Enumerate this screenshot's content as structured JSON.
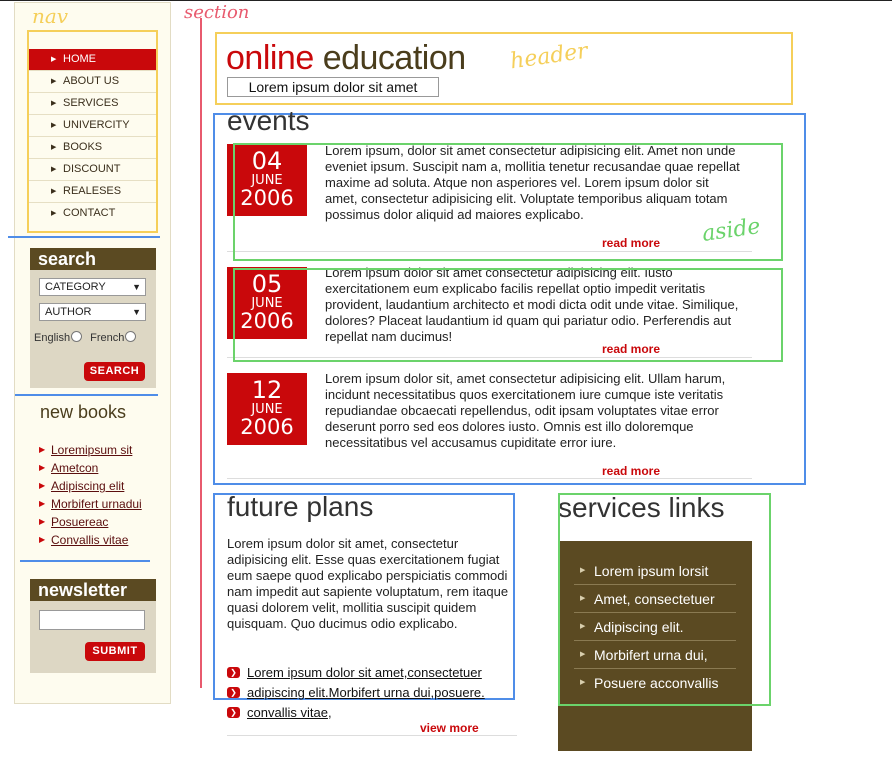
{
  "annotations": {
    "nav": "nav",
    "section": "section",
    "header": "header",
    "aside": "aside"
  },
  "nav": {
    "items": [
      {
        "label": "HOME",
        "active": true
      },
      {
        "label": "ABOUT US"
      },
      {
        "label": "SERVICES"
      },
      {
        "label": "UNIVERCITY"
      },
      {
        "label": "BOOKS"
      },
      {
        "label": "DISCOUNT"
      },
      {
        "label": "REALESES"
      },
      {
        "label": "CONTACT"
      }
    ]
  },
  "search": {
    "title": "search",
    "category": "CATEGORY",
    "author": "AUTHOR",
    "lang1": "English",
    "lang2": "French",
    "button": "SEARCH"
  },
  "new_books": {
    "title": "new books",
    "items": [
      "Loremipsum sit",
      "Ametcon",
      "Adipiscing elit",
      "Morbifert urnadui",
      "Posuereac",
      "Convallis vitae"
    ]
  },
  "newsletter": {
    "title": "newsletter",
    "input_value": "",
    "button": "SUBMIT"
  },
  "header": {
    "title_part1": "online",
    "title_part2": "education",
    "tagline": "Lorem ipsum dolor sit amet"
  },
  "events": {
    "title": "events",
    "items": [
      {
        "day": "04",
        "month": "JUNE",
        "year": "2006",
        "text": "Lorem ipsum, dolor sit amet consectetur adipisicing elit. Amet non unde eveniet ipsum. Suscipit nam a, mollitia tenetur recusandae quae repellat maxime ad soluta. Atque non asperiores vel. Lorem ipsum dolor sit amet, consectetur adipisicing elit. Voluptate temporibus aliquam totam possimus dolor aliquid ad maiores explicabo.",
        "read_more": "read more"
      },
      {
        "day": "05",
        "month": "JUNE",
        "year": "2006",
        "text": "Lorem ipsum dolor sit amet consectetur adipisicing elit. Iusto exercitationem eum explicabo facilis repellat optio impedit veritatis provident, laudantium architecto et modi dicta odit unde vitae. Similique, dolores? Placeat laudantium id quam qui pariatur odio. Perferendis aut repellat nam ducimus!",
        "read_more": "read more"
      },
      {
        "day": "12",
        "month": "JUNE",
        "year": "2006",
        "text": "Lorem ipsum dolor sit, amet consectetur adipisicing elit. Ullam harum, incidunt necessitatibus quos exercitationem iure cumque iste veritatis repudiandae obcaecati repellendus, odit ipsam voluptates vitae error deserunt porro sed eos dolores iusto. Omnis est illo doloremque necessitatibus vel accusamus cupiditate error iure.",
        "read_more": "read more"
      }
    ]
  },
  "future_plans": {
    "title": "future plans",
    "text": "Lorem ipsum dolor sit amet, consectetur adipisicing elit. Esse quas exercitationem fugiat eum saepe quod explicabo perspiciatis commodi nam impedit aut sapiente voluptatum, rem itaque quasi dolorem velit, mollitia suscipit quidem quisquam. Quo ducimus odio explicabo.",
    "links": [
      "Lorem ipsum dolor sit amet,consectetuer",
      "adipiscing elit.Morbifert urna dui,posuere.",
      "convallis vitae"
    ],
    "link3_suffix": ",",
    "view_more": "view more"
  },
  "services": {
    "title": "services links",
    "items": [
      "Lorem ipsum lorsit",
      "Amet, consectetuer",
      "Adipiscing elit.",
      "Morbifert urna dui,",
      "Posuere acconvallis"
    ]
  },
  "colors": {
    "red": "#c9080b",
    "brown": "#5b4a22",
    "blue_outline": "#4f8de8",
    "green_outline": "#6bd36b",
    "yellow_outline": "#f5cf5a"
  }
}
